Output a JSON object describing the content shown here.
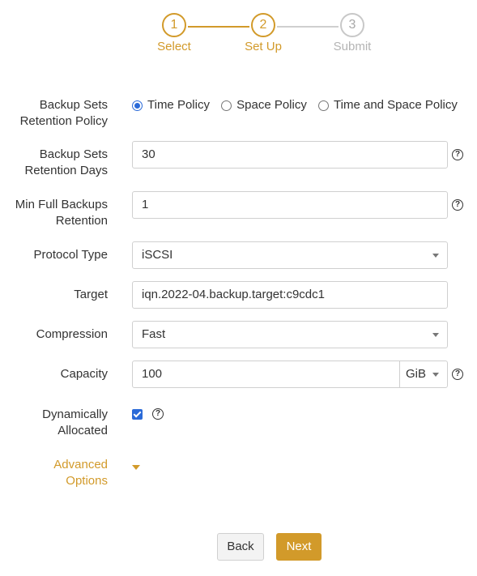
{
  "stepper": {
    "steps": [
      {
        "number": "1",
        "label": "Select"
      },
      {
        "number": "2",
        "label": "Set Up"
      },
      {
        "number": "3",
        "label": "Submit"
      }
    ]
  },
  "form": {
    "retention_policy": {
      "label": "Backup Sets\nRetention Policy",
      "options": [
        "Time Policy",
        "Space Policy",
        "Time and Space Policy"
      ],
      "selected": "Time Policy"
    },
    "retention_days": {
      "label": "Backup Sets\nRetention Days",
      "value": "30"
    },
    "min_full_backups": {
      "label": "Min Full Backups\nRetention",
      "value": "1"
    },
    "protocol_type": {
      "label": "Protocol Type",
      "value": "iSCSI"
    },
    "target": {
      "label": "Target",
      "value": "iqn.2022-04.backup.target:c9cdc1"
    },
    "compression": {
      "label": "Compression",
      "value": "Fast"
    },
    "capacity": {
      "label": "Capacity",
      "value": "100",
      "unit": "GiB"
    },
    "dynamically_allocated": {
      "label": "Dynamically\nAllocated",
      "checked": true
    },
    "advanced_options": {
      "label": "Advanced\nOptions"
    }
  },
  "help_icon_glyph": "?",
  "buttons": {
    "back": "Back",
    "next": "Next"
  },
  "colors": {
    "accent": "#d29a2a",
    "radio_checked": "#2a6ad8",
    "inactive_step": "#c8c8c8"
  }
}
